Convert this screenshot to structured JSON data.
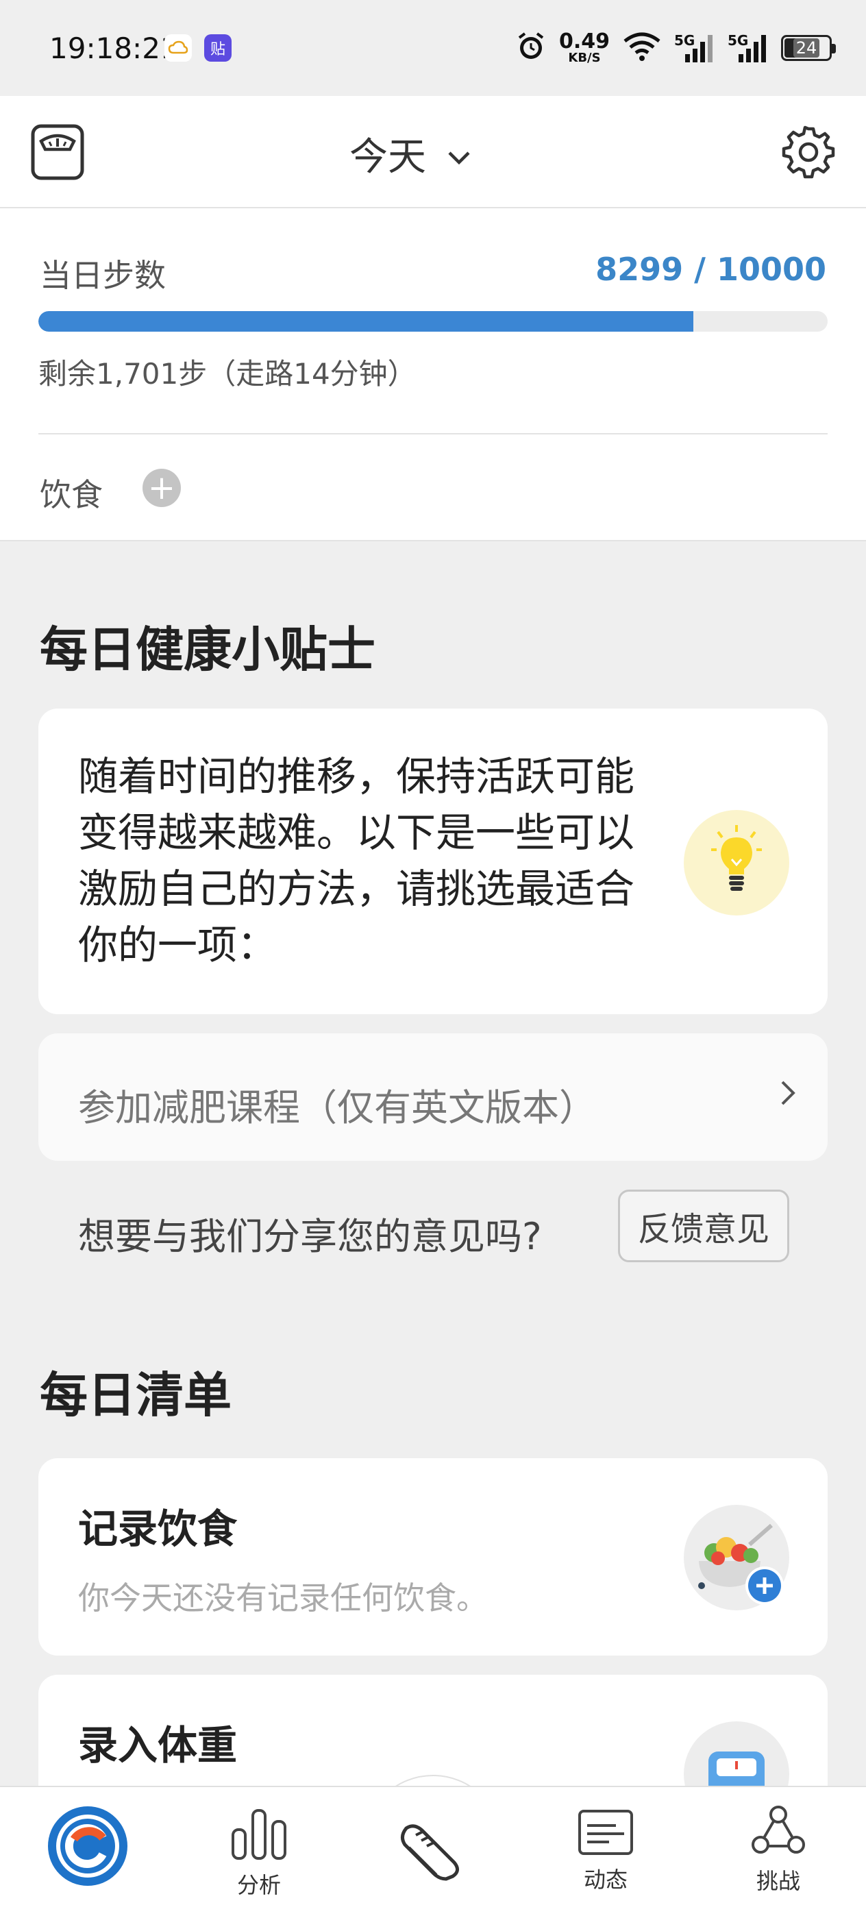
{
  "status_bar": {
    "time": "19:18:21",
    "app_icon_1": "cloud-icon",
    "app_icon_2_text": "贴",
    "net_speed_value": "0.49",
    "net_speed_unit": "KB/S",
    "signal_1_label": "5G",
    "signal_2_label": "5G",
    "battery_level": "24"
  },
  "header": {
    "left_icon": "scale-icon",
    "date_label": "今天",
    "right_icon": "gear-icon"
  },
  "steps": {
    "title": "当日步数",
    "count_text": "8299 / 10000",
    "current": 8299,
    "goal": 10000,
    "progress_fraction": 0.8299,
    "remaining_text": "剩余1,701步（走路14分钟）"
  },
  "diet": {
    "label": "饮食",
    "add_icon": "plus-icon"
  },
  "tips": {
    "section_title": "每日健康小贴士",
    "tip_text": "随着时间的推移，保持活跃可能变得越来越难。以下是一些可以激励自己的方法，请挑选最适合你的一项：",
    "tip_icon": "lightbulb-icon",
    "course_label": "参加减肥课程（仅有英文版本）",
    "feedback_prompt": "想要与我们分享您的意见吗?",
    "feedback_button": "反馈意见"
  },
  "checklist": {
    "section_title": "每日清单",
    "items": [
      {
        "title": "记录饮食",
        "subtitle": "你今天还没有记录任何饮食。",
        "icon": "salad-bowl-icon"
      },
      {
        "title": "录入体重",
        "subtitle": "",
        "icon": "scale-icon"
      }
    ]
  },
  "bottom_nav": {
    "items": [
      {
        "label": "",
        "icon": "app-logo-icon"
      },
      {
        "label": "分析",
        "icon": "bar-chart-icon"
      },
      {
        "label": "",
        "icon": "sneaker-icon"
      },
      {
        "label": "动态",
        "icon": "news-feed-icon"
      },
      {
        "label": "挑战",
        "icon": "challenge-icon"
      }
    ]
  },
  "colors": {
    "accent_blue": "#3b86d4",
    "background": "#efefef",
    "card": "#ffffff"
  }
}
